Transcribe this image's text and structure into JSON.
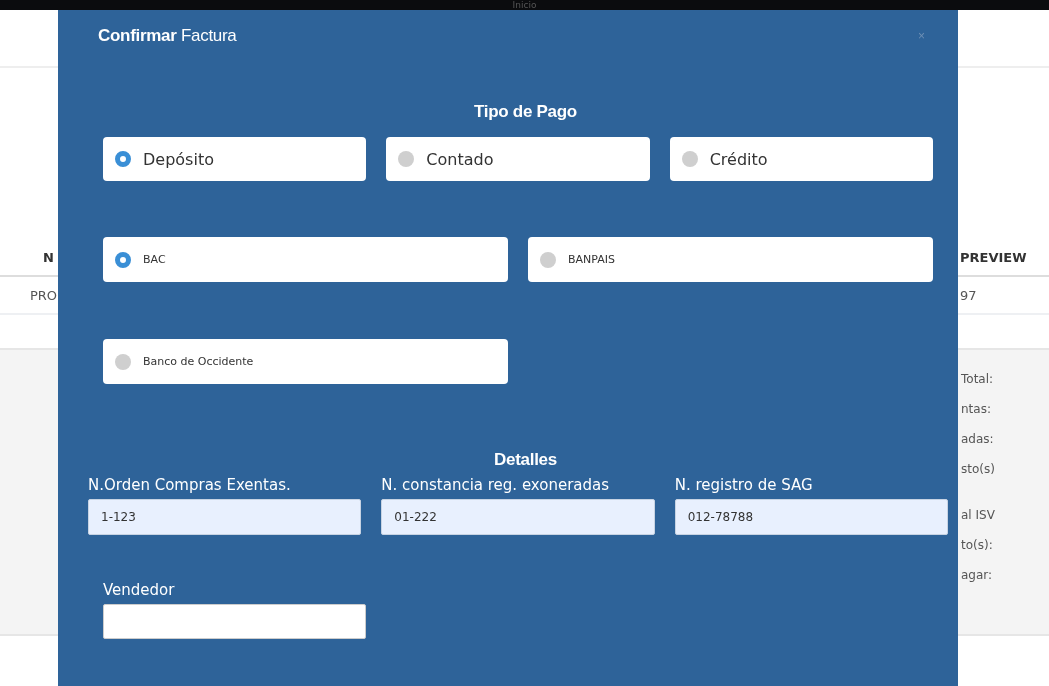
{
  "background_page": {
    "top_bar": {
      "title": "Inicio"
    },
    "table": {
      "columns": [
        {
          "label": "N"
        },
        {
          "label": "PREVIEW"
        }
      ],
      "rows": [
        [
          "PRO",
          "97"
        ]
      ]
    },
    "summary_groups": [
      [
        "Total:",
        "ntas:",
        "adas:",
        "sto(s)"
      ],
      [
        "al ISV",
        "to(s):",
        "agar:"
      ]
    ]
  },
  "dialog": {
    "title_bold": "Confirmar",
    "title": "Factura",
    "close": "×",
    "payment_section": "Tipo de Pago",
    "payment_types": [
      {
        "label": "Depósito",
        "selected": true
      },
      {
        "label": "Contado",
        "selected": false
      },
      {
        "label": "Crédito",
        "selected": false
      }
    ],
    "banks": [
      {
        "label": "BAC",
        "selected": true
      },
      {
        "label": "BANPAIS",
        "selected": false
      },
      {
        "label": "Banco de Occidente",
        "selected": false
      }
    ],
    "details_section": "Detalles",
    "fields": [
      {
        "label": "N.Orden Compras Exentas.",
        "value": "1-123"
      },
      {
        "label": "N. constancia reg. exoneradas",
        "value": "01-222"
      },
      {
        "label": "N. registro de SAG",
        "value": "012-78788"
      }
    ],
    "seller": {
      "label": "Vendedor"
    }
  }
}
